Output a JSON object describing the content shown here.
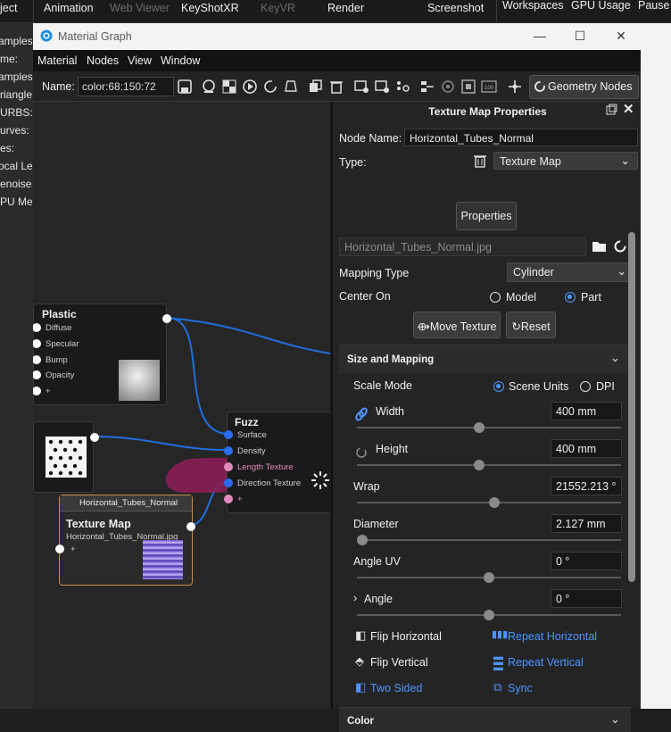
{
  "host": {
    "tabs": [
      "ject",
      "Animation",
      "Web Viewer",
      "KeyShotXR",
      "KeyVR",
      "Render",
      "Screenshot",
      "Workspaces",
      "GPU Usage",
      "Pause"
    ],
    "left_items": [
      "amples",
      "me:",
      "amples",
      "riangle",
      "URBS:",
      "urves:",
      "es:",
      "ocal Le",
      "enoise",
      "PU Me"
    ]
  },
  "window": {
    "title": "Material Graph",
    "menu": [
      "Material",
      "Nodes",
      "View",
      "Window"
    ],
    "name_label": "Name:",
    "name_value": "color:68:150:72",
    "geometry_nodes_label": "Geometry Nodes"
  },
  "graph": {
    "plastic": {
      "title": "Plastic",
      "ports": [
        "Diffuse",
        "Specular",
        "Bump",
        "Opacity",
        "+"
      ]
    },
    "fuzz": {
      "title": "Fuzz",
      "ports": [
        "Surface",
        "Density",
        "Length Texture",
        "Direction Texture",
        "+"
      ]
    },
    "texture_node": {
      "header": "Horizontal_Tubes_Normal",
      "title": "Texture Map",
      "file": "Horizontal_Tubes_Normal.jpg",
      "plus": "+"
    }
  },
  "props": {
    "title": "Texture Map Properties",
    "node_name_label": "Node Name:",
    "node_name_value": "Horizontal_Tubes_Normal",
    "type_label": "Type:",
    "type_value": "Texture Map",
    "properties_button": "Properties",
    "file_field": "Horizontal_Tubes_Normal.jpg",
    "mapping_type_label": "Mapping Type",
    "mapping_type_value": "Cylinder",
    "center_on_label": "Center On",
    "center_model": "Model",
    "center_part": "Part",
    "move_texture": "Move Texture",
    "reset": "Reset",
    "size_section": "Size and Mapping",
    "scale_mode_label": "Scale Mode",
    "scale_scene_units": "Scene Units",
    "scale_dpi": "DPI",
    "width_label": "Width",
    "width_value": "400 mm",
    "width_slider_fraction": 0.46,
    "height_label": "Height",
    "height_value": "400 mm",
    "height_slider_fraction": 0.46,
    "wrap_label": "Wrap",
    "wrap_value": "21552.213 °",
    "wrap_slider_fraction": 0.52,
    "diameter_label": "Diameter",
    "diameter_value": "2.127 mm",
    "diameter_slider_fraction": 0.0,
    "angle_uv_label": "Angle UV",
    "angle_uv_value": "0 °",
    "angle_uv_slider_fraction": 0.5,
    "angle_label": "Angle",
    "angle_value": "0 °",
    "angle_slider_fraction": 0.5,
    "flip_horizontal": "Flip Horizontal",
    "repeat_horizontal": "Repeat Horizontal",
    "flip_vertical": "Flip Vertical",
    "repeat_vertical": "Repeat Vertical",
    "two_sided": "Two Sided",
    "sync": "Sync",
    "color_section": "Color"
  },
  "colors": {
    "accent_blue": "#4d94ff",
    "link_blue": "#1f6fe0",
    "annotation_magenta": "#8c1f57"
  }
}
